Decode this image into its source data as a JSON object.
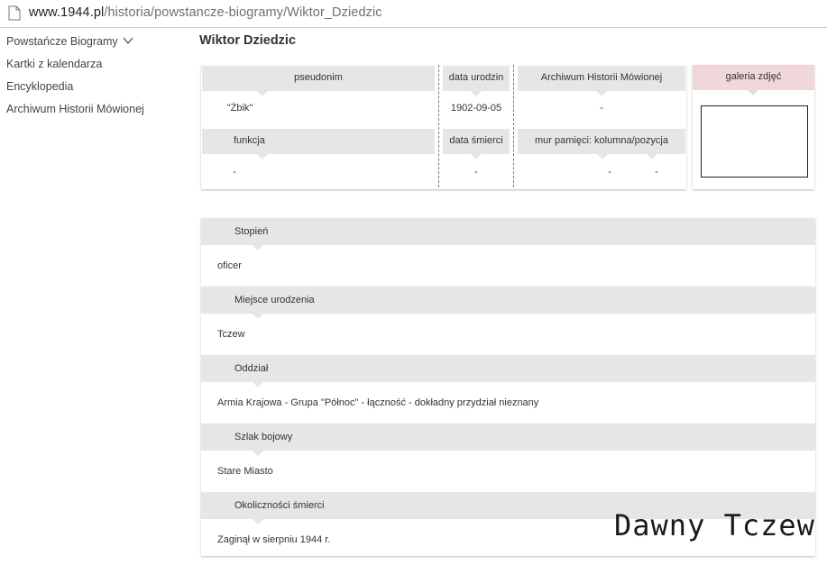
{
  "browser": {
    "url_host": "www.1944.pl",
    "url_path": "/historia/powstancze-biogramy/Wiktor_Dziedzic"
  },
  "sidebar": {
    "items": [
      {
        "label": "Powstańcze Biogramy"
      },
      {
        "label": "Kartki z kalendarza"
      },
      {
        "label": "Encyklopedia"
      },
      {
        "label": "Archiwum Historii Mówionej"
      }
    ]
  },
  "page": {
    "title": "Wiktor Dziedzic"
  },
  "info": {
    "pseudonim": {
      "label": "pseudonim",
      "value": "\"Żbik\""
    },
    "funkcja": {
      "label": "funkcja",
      "value": "-"
    },
    "data_urodzin": {
      "label": "data urodzin",
      "value": "1902-09-05"
    },
    "data_smierci": {
      "label": "data śmierci",
      "value": "-"
    },
    "archiwum": {
      "label": "Archiwum Historii Mówionej",
      "value": "-"
    },
    "mur": {
      "label": "mur pamięci: kolumna/pozycja",
      "kolumna": "-",
      "pozycja": "-"
    },
    "galeria": {
      "label": "galeria zdjęć"
    }
  },
  "sections": [
    {
      "label": "Stopień",
      "value": "oficer"
    },
    {
      "label": "Miejsce urodzenia",
      "value": "Tczew"
    },
    {
      "label": "Oddział",
      "value": "Armia Krajowa - Grupa \"Północ\" - łączność - dokładny przydział nieznany"
    },
    {
      "label": "Szlak bojowy",
      "value": "Stare Miasto"
    },
    {
      "label": "Okoliczności śmierci",
      "value": "Zaginął w sierpniu 1944 r."
    }
  ],
  "watermark": {
    "text": "Dawny Tczew"
  },
  "icons": {
    "page": "document-icon",
    "sidebar_toggle": "chevron-down-icon"
  }
}
